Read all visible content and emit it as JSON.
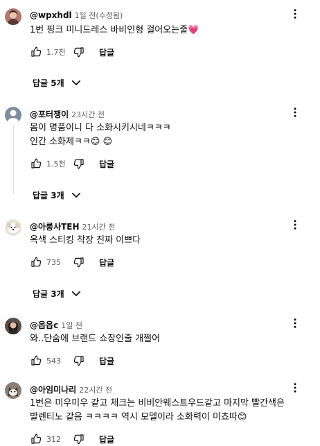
{
  "reply_label": "답글",
  "comments": [
    {
      "author": "@wpxhdl",
      "time": "1일 전(수정됨)",
      "lines": [
        "1번 핑크 미니드레스 바비인형 걸어오는줄💗"
      ],
      "likes": "1.7천",
      "replies": "답글 5개",
      "avatar": "photo-woman"
    },
    {
      "author": "@포터쟁이",
      "time": "23시간 전",
      "lines": [
        "몸이 명품이니 다 소화시키시네ㅋㅋㅋ",
        "인간 소화제ㅋㅋ😊 😊"
      ],
      "likes": "1.5천",
      "replies": "답글 3개",
      "avatar": "default-person"
    },
    {
      "author": "@아룽사TEH",
      "time": "21시간 전",
      "lines": [
        "옥색 스티킹 착장 진짜 이쁘다"
      ],
      "likes": "735",
      "replies": "답글 3개",
      "avatar": "photo-dog"
    },
    {
      "author": "@옵옵c",
      "time": "1일 전",
      "lines": [
        "와..단숨에 브랜드 쇼장인줄 개쩔어"
      ],
      "likes": "543",
      "replies": "",
      "avatar": "photo-woman-dark"
    },
    {
      "author": "@아임미나리",
      "time": "22시간 전",
      "lines": [
        "1번은 미우미우 같고 체크는 비비안웨스트우드같고 마지막 빨간색은",
        "발렌티노 같음 ㅋㅋㅋㅋ 역시 모델이라 소화력이 미쵸따😊"
      ],
      "likes": "312",
      "replies": "",
      "avatar": "photo-cat"
    }
  ],
  "icons": {
    "like": "thumb-up-icon",
    "dislike": "thumb-down-icon",
    "menu": "more-vert-icon",
    "expand": "chevron-down-icon"
  },
  "colors": {
    "text": "#0f0f0f",
    "secondary": "#606060",
    "thread_line": "#e5e5e5"
  }
}
